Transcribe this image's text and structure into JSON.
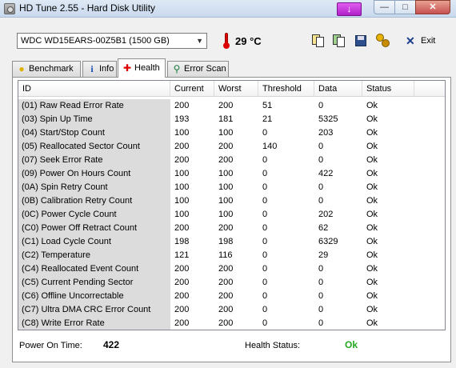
{
  "window": {
    "title": "HD Tune 2.55 - Hard Disk Utility",
    "tray_glyph": "↓",
    "minimize_glyph": "—",
    "maximize_glyph": "□",
    "close_glyph": "✕"
  },
  "toolbar": {
    "drive": "WDC WD15EARS-00Z5B1 (1500 GB)",
    "temperature": "29 °C",
    "exit_label": "Exit",
    "exit_glyph": "✕"
  },
  "tabs": [
    {
      "label": "Benchmark",
      "icon": "bulb-icon",
      "glyph": "💡"
    },
    {
      "label": "Info",
      "icon": "info-icon",
      "glyph": "i"
    },
    {
      "label": "Health",
      "icon": "red-cross-icon",
      "glyph": "✚"
    },
    {
      "label": "Error Scan",
      "icon": "magnifier-icon",
      "glyph": "🔍"
    }
  ],
  "table": {
    "columns": [
      "ID",
      "Current",
      "Worst",
      "Threshold",
      "Data",
      "Status"
    ],
    "rows": [
      [
        "(01) Raw Read Error Rate",
        "200",
        "200",
        "51",
        "0",
        "Ok"
      ],
      [
        "(03) Spin Up Time",
        "193",
        "181",
        "21",
        "5325",
        "Ok"
      ],
      [
        "(04) Start/Stop Count",
        "100",
        "100",
        "0",
        "203",
        "Ok"
      ],
      [
        "(05) Reallocated Sector Count",
        "200",
        "200",
        "140",
        "0",
        "Ok"
      ],
      [
        "(07) Seek Error Rate",
        "200",
        "200",
        "0",
        "0",
        "Ok"
      ],
      [
        "(09) Power On Hours Count",
        "100",
        "100",
        "0",
        "422",
        "Ok"
      ],
      [
        "(0A) Spin Retry Count",
        "100",
        "100",
        "0",
        "0",
        "Ok"
      ],
      [
        "(0B) Calibration Retry Count",
        "100",
        "100",
        "0",
        "0",
        "Ok"
      ],
      [
        "(0C) Power Cycle Count",
        "100",
        "100",
        "0",
        "202",
        "Ok"
      ],
      [
        "(C0) Power Off Retract Count",
        "200",
        "200",
        "0",
        "62",
        "Ok"
      ],
      [
        "(C1) Load Cycle Count",
        "198",
        "198",
        "0",
        "6329",
        "Ok"
      ],
      [
        "(C2) Temperature",
        "121",
        "116",
        "0",
        "29",
        "Ok"
      ],
      [
        "(C4) Reallocated Event Count",
        "200",
        "200",
        "0",
        "0",
        "Ok"
      ],
      [
        "(C5) Current Pending Sector",
        "200",
        "200",
        "0",
        "0",
        "Ok"
      ],
      [
        "(C6) Offline Uncorrectable",
        "200",
        "200",
        "0",
        "0",
        "Ok"
      ],
      [
        "(C7) Ultra DMA CRC Error Count",
        "200",
        "200",
        "0",
        "0",
        "Ok"
      ],
      [
        "(C8) Write Error Rate",
        "200",
        "200",
        "0",
        "0",
        "Ok"
      ]
    ]
  },
  "footer": {
    "power_on_label": "Power On Time:",
    "power_on_value": "422",
    "health_label": "Health Status:",
    "health_value": "Ok",
    "health_color": "#22aa22"
  }
}
